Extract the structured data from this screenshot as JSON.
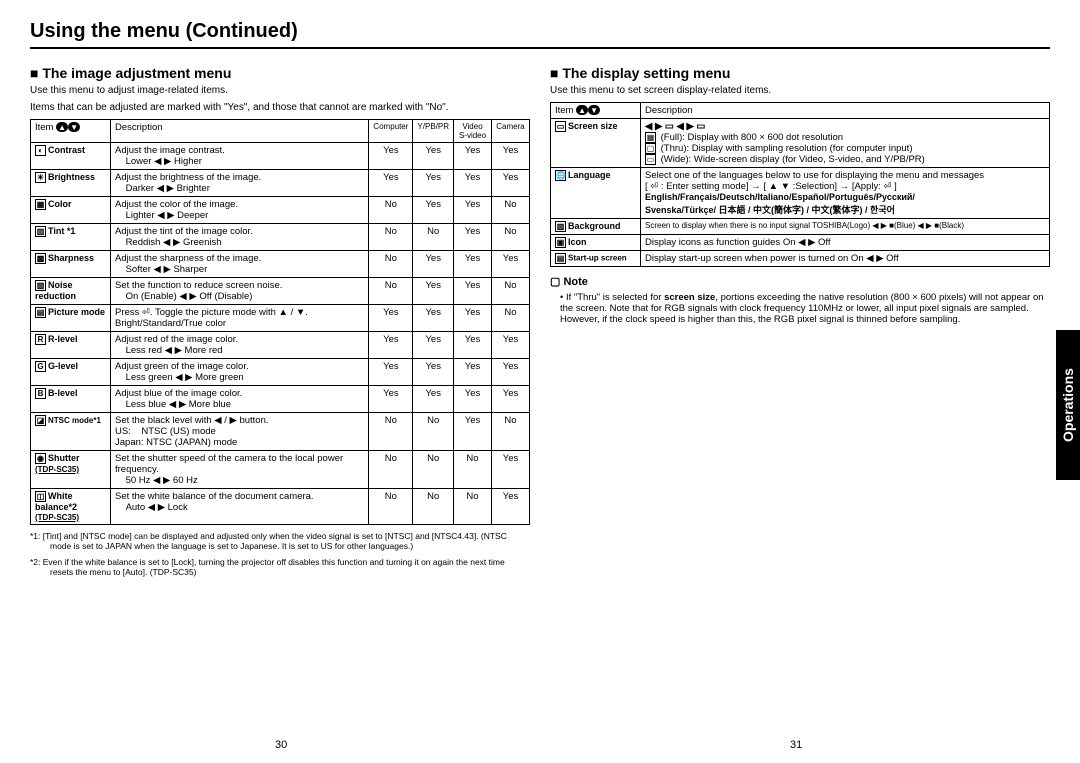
{
  "main_title": "Using the menu (Continued)",
  "side_tab": "Operations",
  "page_left": "30",
  "page_right": "31",
  "left": {
    "title": "The image adjustment menu",
    "intro1": "Use this menu to adjust image-related items.",
    "intro2": "Items that can be adjusted are marked with \"Yes\", and those that cannot are marked with \"No\".",
    "headers": [
      "Item",
      "Description",
      "Computer",
      "Y/PB/PR",
      "Video S-video",
      "Camera"
    ],
    "rows": [
      {
        "item": "Contrast",
        "desc": "Adjust the image contrast.",
        "ctrl": "Lower ◀ ▶ Higher",
        "c": "Yes",
        "y": "Yes",
        "v": "Yes",
        "cam": "Yes"
      },
      {
        "item": "Brightness",
        "desc": "Adjust the brightness of the image.",
        "ctrl": "Darker ◀ ▶ Brighter",
        "c": "Yes",
        "y": "Yes",
        "v": "Yes",
        "cam": "Yes"
      },
      {
        "item": "Color",
        "desc": "Adjust the color of the image.",
        "ctrl": "Lighter ◀ ▶ Deeper",
        "c": "No",
        "y": "Yes",
        "v": "Yes",
        "cam": "No"
      },
      {
        "item": "Tint *1",
        "desc": "Adjust the tint of the image color.",
        "ctrl": "Reddish ◀ ▶ Greenish",
        "c": "No",
        "y": "No",
        "v": "Yes",
        "cam": "No"
      },
      {
        "item": "Sharpness",
        "desc": "Adjust the sharpness of the image.",
        "ctrl": "Softer ◀ ▶ Sharper",
        "c": "No",
        "y": "Yes",
        "v": "Yes",
        "cam": "Yes"
      },
      {
        "item": "Noise reduction",
        "desc": "Set the function to reduce screen noise.",
        "ctrl": "On (Enable) ◀ ▶ Off (Disable)",
        "c": "No",
        "y": "Yes",
        "v": "Yes",
        "cam": "No"
      },
      {
        "item": "Picture mode",
        "desc": "Press ⏎. Toggle the picture mode with ▲ / ▼.",
        "ctrl": "Bright/Standard/True color",
        "c": "Yes",
        "y": "Yes",
        "v": "Yes",
        "cam": "No"
      },
      {
        "item": "R-level",
        "desc": "Adjust red of the image color.",
        "ctrl": "Less red ◀ ▶ More red",
        "c": "Yes",
        "y": "Yes",
        "v": "Yes",
        "cam": "Yes"
      },
      {
        "item": "G-level",
        "desc": "Adjust green of the image color.",
        "ctrl": "Less green ◀ ▶ More green",
        "c": "Yes",
        "y": "Yes",
        "v": "Yes",
        "cam": "Yes"
      },
      {
        "item": "B-level",
        "desc": "Adjust blue of the image color.",
        "ctrl": "Less blue ◀ ▶ More blue",
        "c": "Yes",
        "y": "Yes",
        "v": "Yes",
        "cam": "Yes"
      },
      {
        "item": "NTSC mode*1",
        "desc": "Set the black level with ◀ / ▶ button.",
        "ctrl": "US:    NTSC (US) mode\nJapan: NTSC (JAPAN) mode",
        "c": "No",
        "y": "No",
        "v": "Yes",
        "cam": "No"
      },
      {
        "item": "Shutter",
        "sub": "(TDP-SC35)",
        "desc": "Set the shutter speed of the camera to the local power frequency.",
        "ctrl": "50 Hz ◀ ▶ 60 Hz",
        "c": "No",
        "y": "No",
        "v": "No",
        "cam": "Yes"
      },
      {
        "item": "White balance*2",
        "sub": "(TDP-SC35)",
        "desc": "Set the white balance of the document camera.",
        "ctrl": "Auto ◀ ▶ Lock",
        "c": "No",
        "y": "No",
        "v": "No",
        "cam": "Yes"
      }
    ],
    "footnote1": "*1: [Tint] and [NTSC mode] can be displayed and adjusted only when the video signal is set to [NTSC] and [NTSC4.43]. (NTSC mode is set to JAPAN when the language is set to Japanese. It is set to US for other languages.)",
    "footnote2": "*2: Even if the white balance is set to [Lock], turning the projector off disables this function and turning it on again the next time resets the menu to [Auto]. (TDP-SC35)"
  },
  "right": {
    "title": "The display setting menu",
    "intro": "Use this menu to set screen display-related items.",
    "headers": [
      "Item",
      "Description"
    ],
    "rows": [
      {
        "item": "Screen size",
        "lines": [
          "◀ ▶ ▭ ◀ ▶ ▭",
          "(Full): Display with 800 × 600 dot resolution",
          "(Thru): Display with sampling resolution (for computer input)",
          "(Wide): Wide-screen display (for Video, S-video, and Y/PB/PR)"
        ]
      },
      {
        "item": "Language",
        "lines": [
          "Select one of the languages below to use for displaying the menu and messages",
          "[ ⏎ : Enter setting mode] → [ ▲ ▼ :Selection] → [Apply: ⏎ ]",
          "English/Français/Deutsch/Italiano/Español/Português/Русский/",
          "Svenska/Türkçe/ 日本語 / 中文(簡体字) / 中文(繁体字) / 한국어"
        ]
      },
      {
        "item": "Background",
        "lines": [
          "Screen to display when there is no input signal  TOSHIBA(Logo) ◀ ▶ ■(Blue) ◀ ▶ ■(Black)"
        ]
      },
      {
        "item": "Icon",
        "lines": [
          "Display icons as function guides                                          On ◀ ▶ Off"
        ]
      },
      {
        "item": "Start-up screen",
        "lines": [
          "Display start-up screen when power is turned on      On ◀ ▶ Off"
        ]
      }
    ],
    "note_head": "Note",
    "note_body": "If \"Thru\" is selected for screen size, portions exceeding the native resolution (800 × 600 pixels) will not appear on the screen. Note that for RGB signals with clock frequency 110MHz or lower, all input pixel signals are sampled. However, if the clock speed is higher than this, the RGB pixel signal is thinned before sampling.",
    "note_bold1": "screen size"
  }
}
